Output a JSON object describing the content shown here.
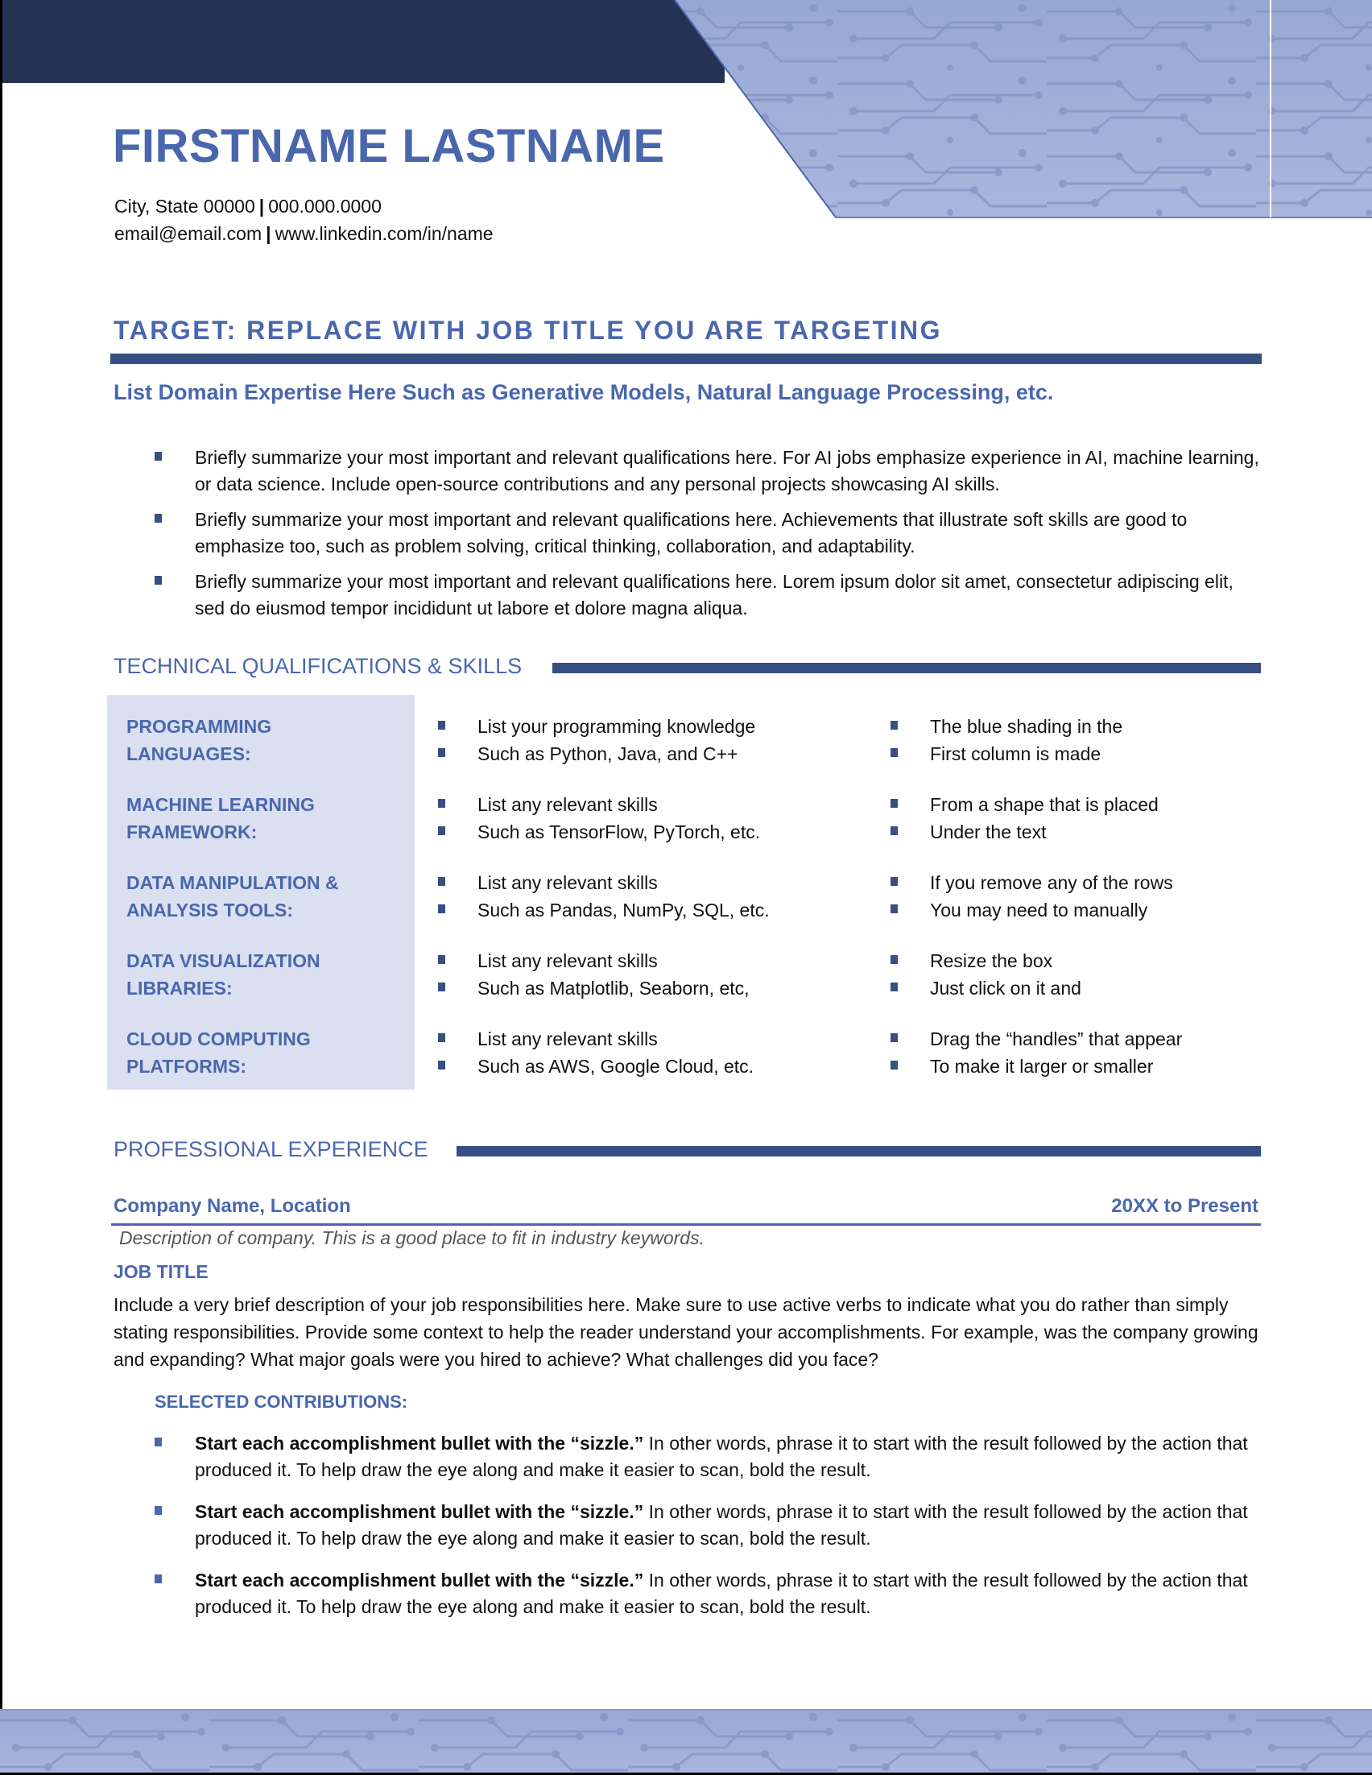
{
  "colors": {
    "navy": "#243254",
    "accent_blue": "#4a67ad",
    "rule_blue": "#374f82",
    "skills_shading": "#dae0f0",
    "circuit_fill": "#9fadd6"
  },
  "header": {
    "name": "FIRSTNAME LASTNAME",
    "contact_line1": {
      "location": "City, State 00000",
      "phone": "000.000.0000"
    },
    "contact_line2": {
      "email": "email@email.com",
      "linkedin": "www.linkedin.com/in/name"
    },
    "separator": "|"
  },
  "target": {
    "title": "TARGET: REPLACE WITH JOB TITLE YOU ARE TARGETING",
    "domain_expertise": "List Domain Expertise Here Such as Generative Models, Natural Language Processing, etc.",
    "summary_bullets": [
      "Briefly summarize your most important and relevant qualifications here. For AI jobs emphasize experience in AI, machine learning, or data science. Include open-source contributions and any personal projects showcasing AI skills.",
      "Briefly summarize your most important and relevant qualifications here. Achievements that illustrate soft skills are good to emphasize too, such as problem solving, critical thinking, collaboration, and adaptability.",
      "Briefly summarize your most important and relevant qualifications here. Lorem ipsum dolor sit amet, consectetur adipiscing elit, sed do eiusmod tempor incididunt ut labore et dolore magna aliqua."
    ]
  },
  "skills": {
    "title": "TECHNICAL QUALIFICATIONS & SKILLS",
    "rows": [
      {
        "category": "PROGRAMMING LANGUAGES:",
        "col_a": [
          "List your programming knowledge",
          "Such as Python, Java, and C++"
        ],
        "col_b": [
          "The blue shading in the",
          "First column is made"
        ]
      },
      {
        "category": "MACHINE LEARNING FRAMEWORK:",
        "col_a": [
          "List any relevant skills",
          "Such as TensorFlow, PyTorch, etc."
        ],
        "col_b": [
          "From a shape that is placed",
          "Under the text"
        ]
      },
      {
        "category": "DATA MANIPULATION & ANALYSIS TOOLS:",
        "col_a": [
          "List any relevant skills",
          "Such as Pandas, NumPy, SQL, etc."
        ],
        "col_b": [
          "If you remove any of the rows",
          "You may need to manually"
        ]
      },
      {
        "category": "DATA VISUALIZATION LIBRARIES:",
        "col_a": [
          "List any relevant skills",
          "Such as Matplotlib, Seaborn, etc,"
        ],
        "col_b": [
          "Resize the box",
          "Just click on it and"
        ]
      },
      {
        "category": "CLOUD COMPUTING PLATFORMS:",
        "col_a": [
          "List any relevant skills",
          "Such as AWS, Google Cloud, etc."
        ],
        "col_b": [
          "Drag the “handles” that appear",
          "To make it larger or smaller"
        ]
      }
    ]
  },
  "experience": {
    "title": "PROFESSIONAL EXPERIENCE",
    "company": "Company Name, Location",
    "dates": "20XX to Present",
    "company_description": "Description of company. This is a good place to fit in industry keywords.",
    "job_title": "JOB TITLE",
    "job_description": "Include a very brief description of your job responsibilities here. Make sure to use active verbs to indicate what you do rather than simply stating responsibilities. Provide some context to help the reader understand your accomplishments. For example, was the company growing and expanding? What major goals were you hired to achieve? What challenges did you face?",
    "contributions_title": "SELECTED CONTRIBUTIONS:",
    "contributions": [
      {
        "bold": "Start each accomplishment bullet with the “sizzle.”",
        "text": " In other words, phrase it to start with the result followed by the action that produced it. To help draw the eye along and make it easier to scan, bold the result."
      },
      {
        "bold": "Start each accomplishment bullet with the “sizzle.”",
        "text": " In other words, phrase it to start with the result followed by the action that produced it. To help draw the eye along and make it easier to scan, bold the result."
      },
      {
        "bold": "Start each accomplishment bullet with the “sizzle.”",
        "text": " In other words, phrase it to start with the result followed by the action that produced it. To help draw the eye along and make it easier to scan, bold the result."
      }
    ]
  }
}
